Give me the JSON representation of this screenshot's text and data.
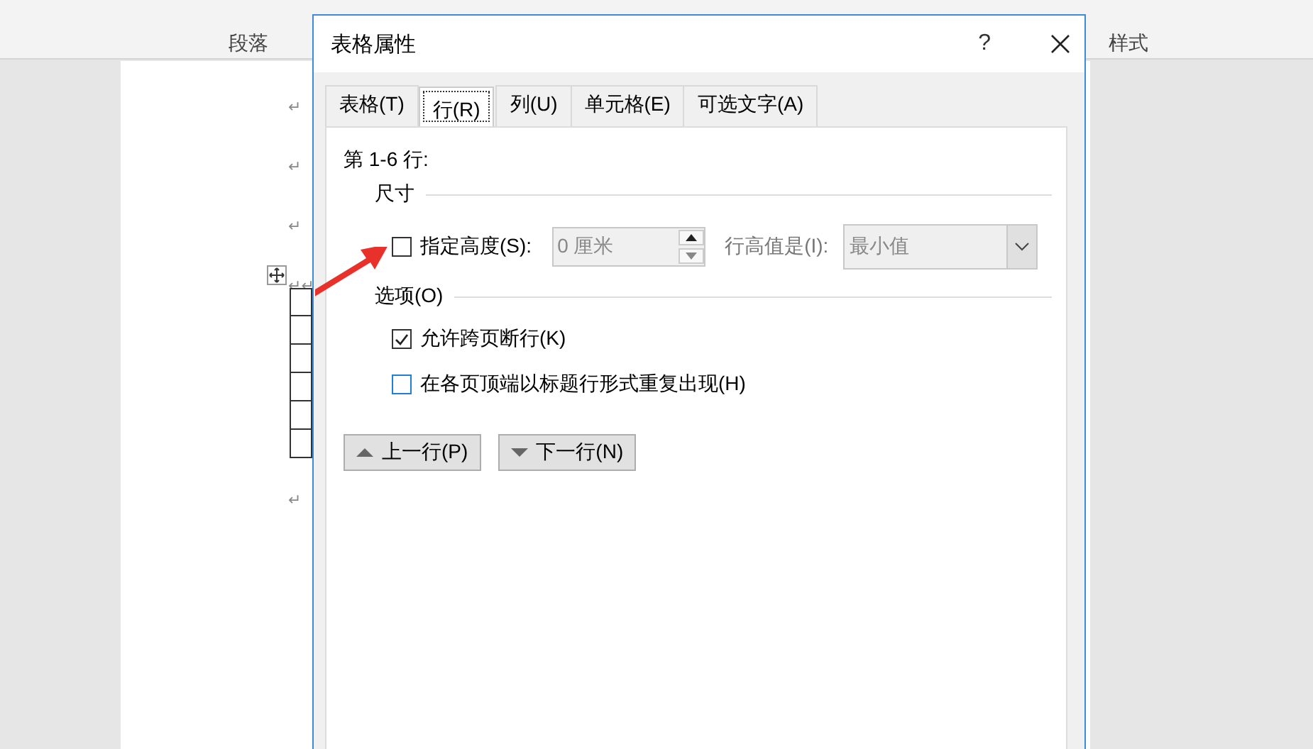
{
  "ribbon": {
    "groups": [
      {
        "label": "段落"
      },
      {
        "label": "样式"
      }
    ]
  },
  "document": {
    "paragraph_marks": [
      "↵",
      "↵",
      "↵",
      "↵↵",
      "↵"
    ]
  },
  "dialog": {
    "title": "表格属性",
    "help": "?",
    "tabs": [
      {
        "label": "表格(T)",
        "selected": false
      },
      {
        "label": "行(R)",
        "selected": true
      },
      {
        "label": "列(U)",
        "selected": false
      },
      {
        "label": "单元格(E)",
        "selected": false
      },
      {
        "label": "可选文字(A)",
        "selected": false
      }
    ],
    "section_label": "第 1-6 行:",
    "size_group": {
      "title": "尺寸",
      "height_checkbox": {
        "label": "指定高度(S):",
        "checked": false
      },
      "height_field": {
        "value": "0 厘米",
        "disabled": true
      },
      "row_height_label": "行高值是(I):",
      "row_height_select": {
        "value": "最小值",
        "disabled": true
      }
    },
    "options_group": {
      "title": "选项(O)",
      "checkboxes": [
        {
          "label": "允许跨页断行(K)",
          "checked": true
        },
        {
          "label": "在各页顶端以标题行形式重复出现(H)",
          "checked": false
        }
      ]
    },
    "nav_buttons": [
      {
        "label": "上一行(P)",
        "kind": "up"
      },
      {
        "label": "下一行(N)",
        "kind": "down"
      }
    ]
  }
}
